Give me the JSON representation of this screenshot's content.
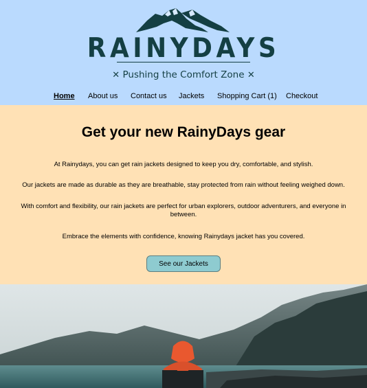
{
  "brand": {
    "name": "RAINYDAYS",
    "tagline": "Pushing the Comfort Zone",
    "tagline_mark": "✕"
  },
  "nav": {
    "items": [
      {
        "label": "Home",
        "active": true
      },
      {
        "label": "About us"
      },
      {
        "label": "Contact us"
      },
      {
        "label": "Jackets"
      },
      {
        "label": "Shopping Cart (1)"
      },
      {
        "label": "Checkout"
      }
    ]
  },
  "hero": {
    "title": "Get your new RainyDays gear",
    "paragraphs": [
      "At Rainydays, you can get rain jackets designed to keep you dry, comfortable, and stylish.",
      "Our jackets are made as durable as they are breathable, stay protected from rain without feeling weighed down.",
      "With comfort and flexibility, our rain jackets are perfect for urban explorers, outdoor adventurers, and everyone in between.",
      "Embrace the elements with confidence, knowing Rainydays jacket has you covered."
    ],
    "cta_label": "See our Jackets"
  },
  "colors": {
    "header_bg": "#badafe",
    "hero_bg": "#ffe1b5",
    "brand": "#143f43",
    "cta_bg": "#8ecbd0"
  },
  "icons": {
    "logo": "mountain-logo-icon"
  }
}
